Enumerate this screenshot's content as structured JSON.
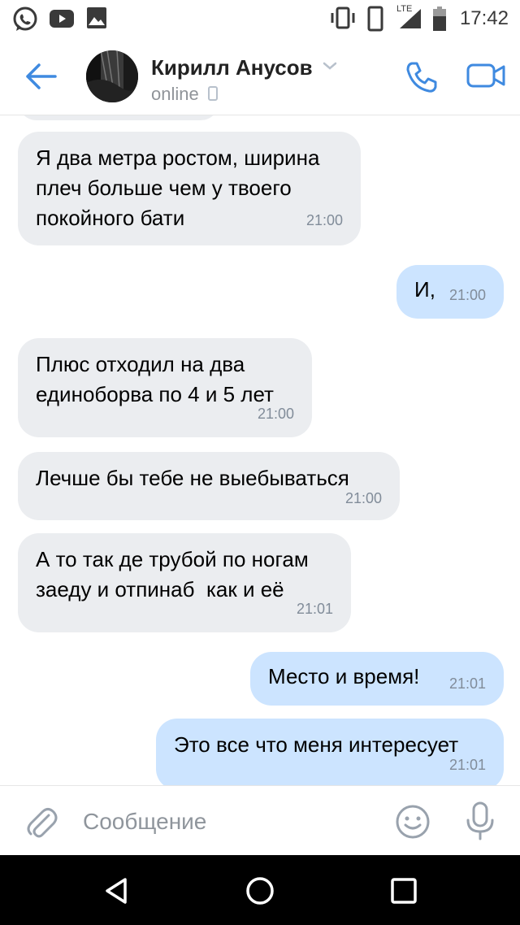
{
  "status_bar": {
    "time": "17:42",
    "network": "LTE",
    "icons": [
      "whatsapp-icon",
      "youtube-icon",
      "gallery-icon",
      "vibrate-icon",
      "phone-icon",
      "signal-icon",
      "battery-icon"
    ]
  },
  "header": {
    "contact_name": "Кирилл Анусов",
    "status": "online",
    "icons": [
      "back-arrow-icon",
      "chevron-down-icon",
      "call-icon",
      "video-call-icon"
    ]
  },
  "messages": [
    {
      "direction": "in",
      "text": "Я два метра ростом, ширина\nплеч больше чем у твоего\nпокойного бати",
      "time": "21:00"
    },
    {
      "direction": "out",
      "text": "И,",
      "time": "21:00"
    },
    {
      "direction": "in",
      "text": "Плюс отходил на два\nединоборва по 4 и 5 лет",
      "time": "21:00"
    },
    {
      "direction": "in",
      "text": "Лечше бы тебе не выебываться",
      "time": "21:00"
    },
    {
      "direction": "in",
      "text": "А то так де трубой по ногам\nзаеду и отпинаб  как и её",
      "time": "21:01"
    },
    {
      "direction": "out",
      "text": "Место и время!",
      "time": "21:01"
    },
    {
      "direction": "out",
      "text": "Это все что меня интересует",
      "time": "21:01"
    }
  ],
  "composer": {
    "placeholder": "Сообщение",
    "icons": [
      "attach-icon",
      "emoji-icon",
      "microphone-icon"
    ]
  },
  "colors": {
    "accent": "#3f8ae0",
    "incoming_bubble": "#ebedf0",
    "outgoing_bubble": "#cce4ff",
    "time_text": "#818c99"
  }
}
